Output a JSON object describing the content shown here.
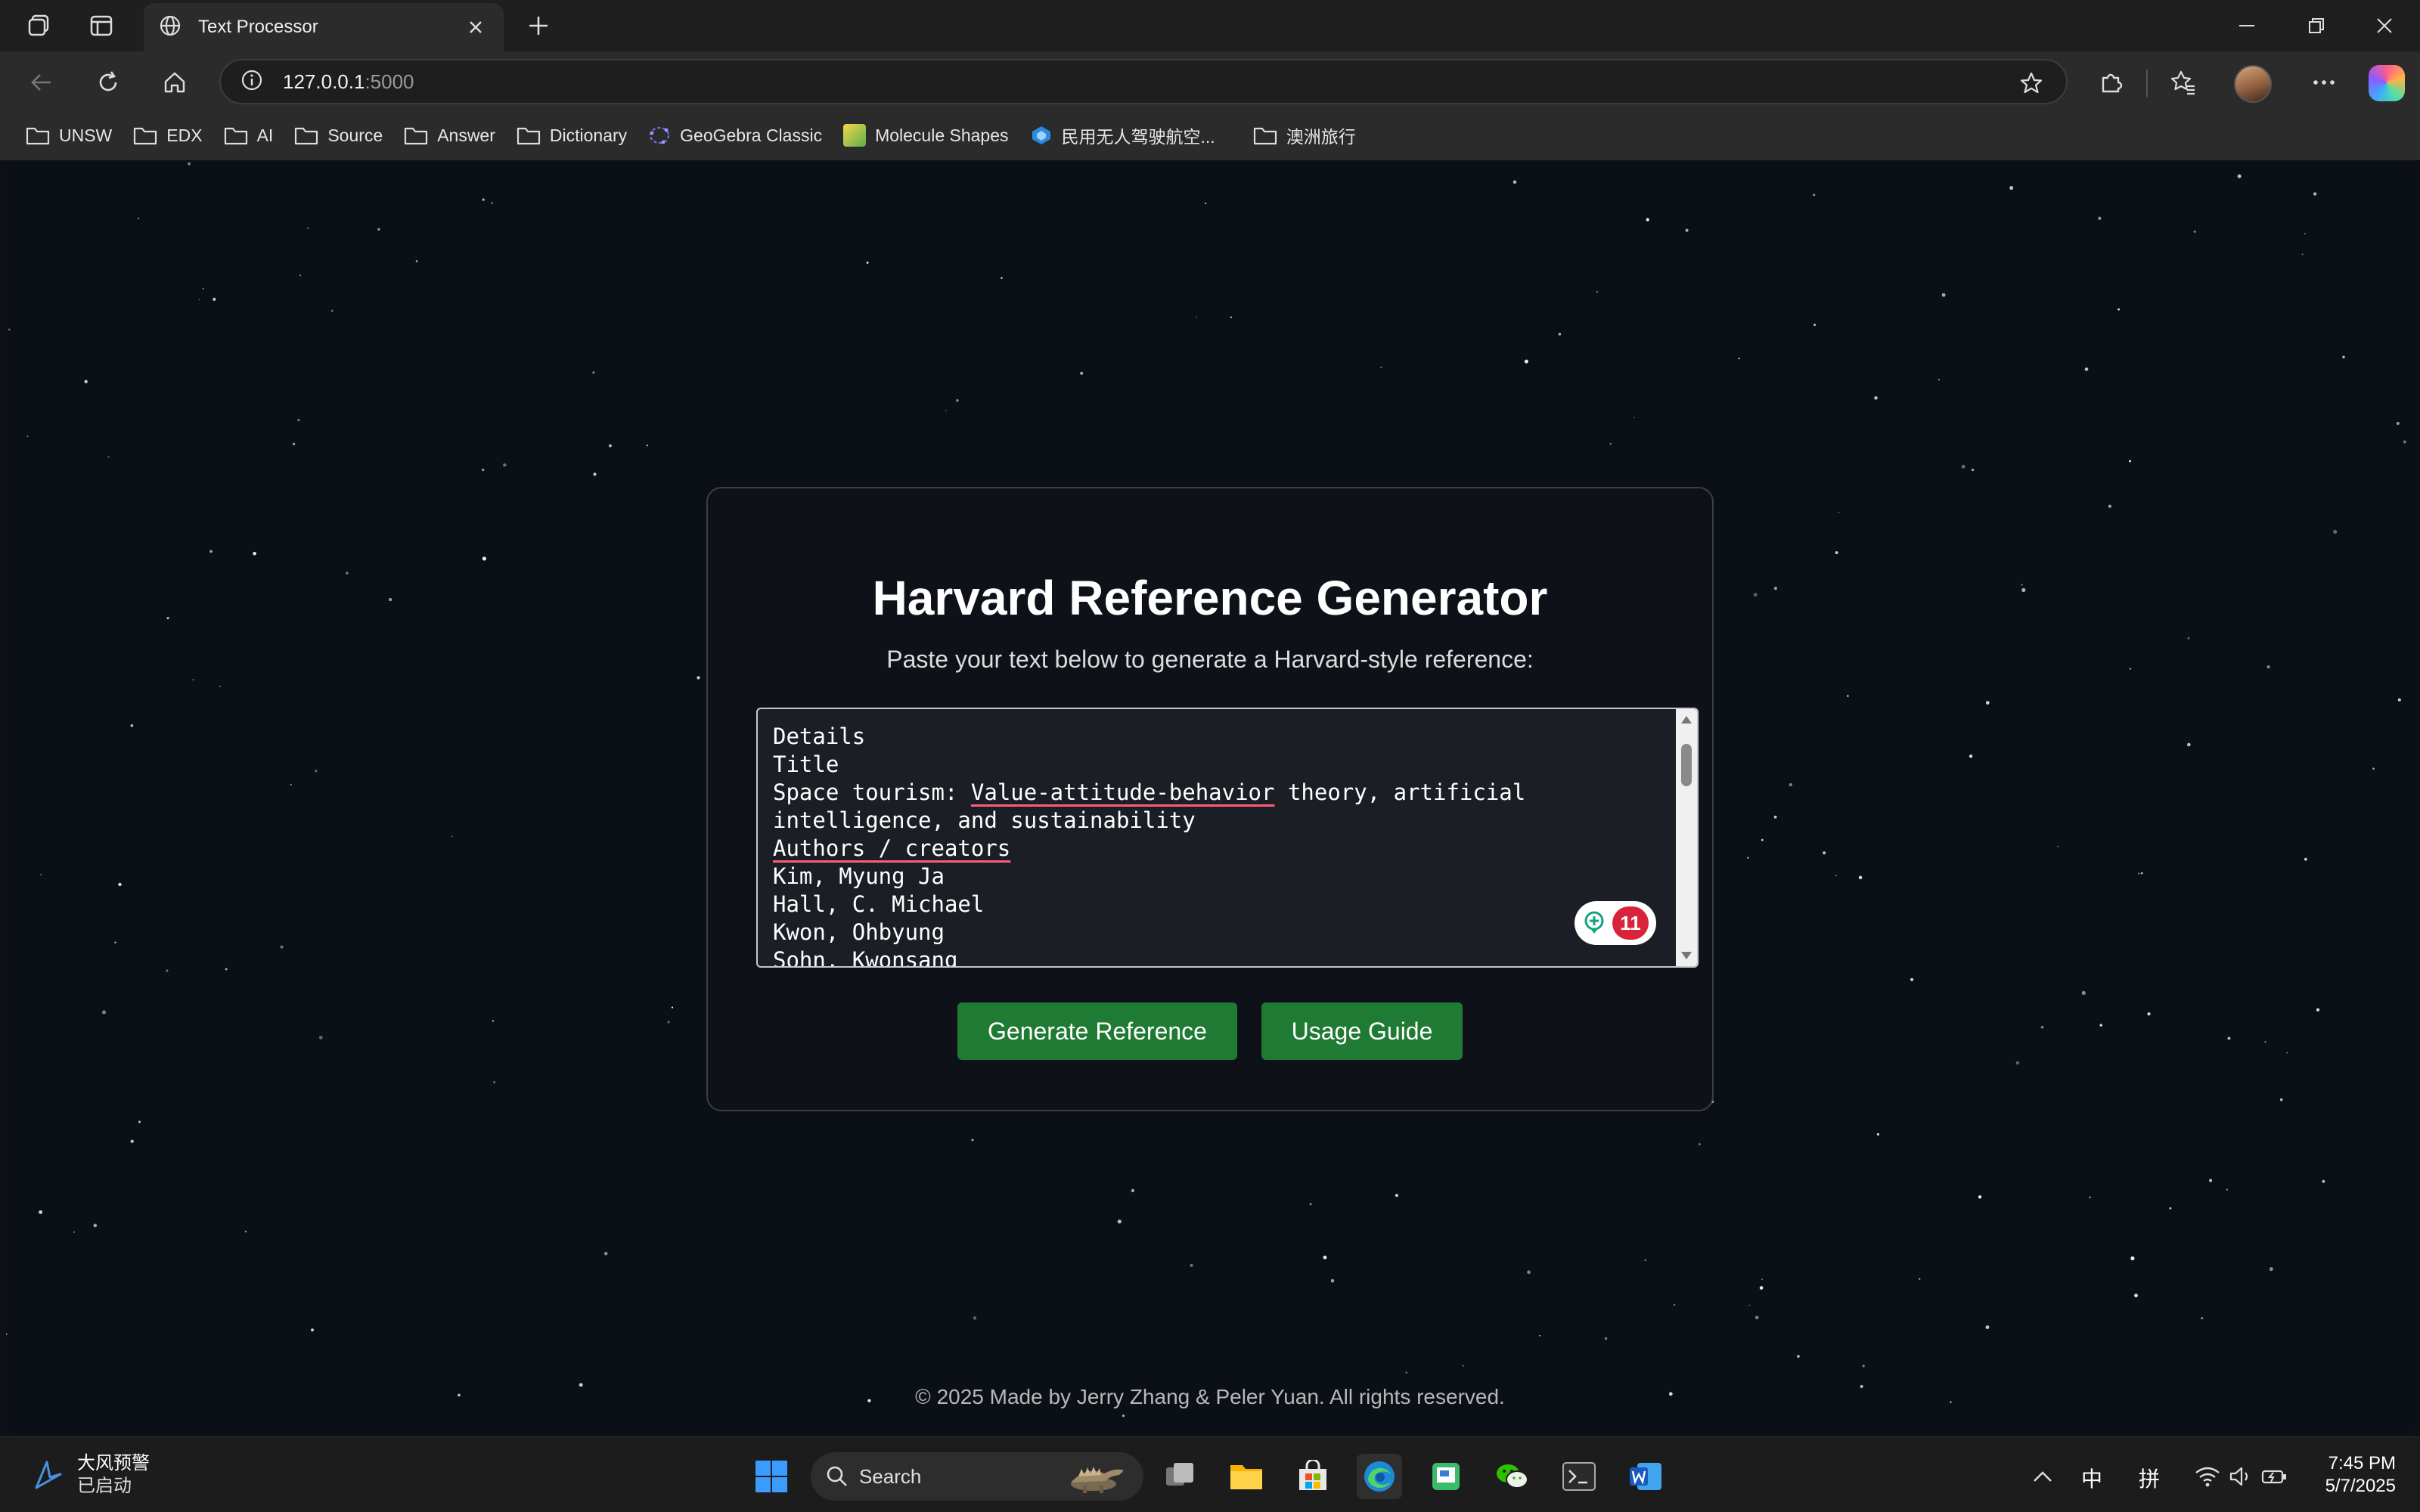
{
  "browser": {
    "tab_title": "Text Processor",
    "url_host": "127.0.0.1",
    "url_port": ":5000",
    "bookmarks": [
      {
        "label": "UNSW",
        "icon": "folder-icon"
      },
      {
        "label": "EDX",
        "icon": "folder-icon"
      },
      {
        "label": "AI",
        "icon": "folder-icon"
      },
      {
        "label": "Source",
        "icon": "folder-icon"
      },
      {
        "label": "Answer",
        "icon": "folder-icon"
      },
      {
        "label": "Dictionary",
        "icon": "folder-icon"
      },
      {
        "label": "GeoGebra Classic",
        "icon": "geogebra-icon"
      },
      {
        "label": "Molecule Shapes",
        "icon": "phet-icon"
      },
      {
        "label": "民用无人驾驶航空...",
        "icon": "drone-site-icon"
      },
      {
        "label": "澳洲旅行",
        "icon": "folder-icon"
      }
    ]
  },
  "app": {
    "title": "Harvard Reference Generator",
    "subtitle": "Paste your text below to generate a Harvard-style reference:",
    "textarea": {
      "line1": "Details",
      "line2": "Title",
      "line3_prefix": "Space tourism: ",
      "line3_underlined": "Value-attitude-behavior",
      "line3_suffix": " theory, artificial",
      "line4": "intelligence, and sustainability",
      "line5": "Authors / creators",
      "line6": "Kim, Myung Ja",
      "line7": "Hall, C. Michael",
      "line8": "Kwon, Ohbyung",
      "line9": "Sohn, Kwonsang"
    },
    "grammar_count": "11",
    "generate_label": "Generate Reference",
    "guide_label": "Usage Guide",
    "footer": "© 2025 Made by Jerry Zhang & Peler Yuan. All rights reserved."
  },
  "taskbar": {
    "weather_title": "大风预警",
    "weather_sub": "已启动",
    "search_placeholder": "Search",
    "ime_lang": "中",
    "ime_mode": "拼",
    "time": "7:45 PM",
    "date": "5/7/2025"
  },
  "colors": {
    "page_bg": "#0b0f16",
    "button_green": "#1f7a33",
    "grammar_red": "#d9233b"
  }
}
